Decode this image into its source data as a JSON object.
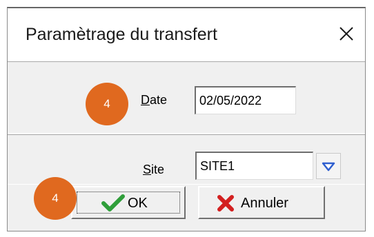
{
  "dialog": {
    "title": "Paramètrage du transfert",
    "close_icon": "close-icon"
  },
  "date": {
    "label_accel": "D",
    "label_rest": "ate",
    "value": "02/05/2022"
  },
  "site": {
    "label_accel": "S",
    "label_rest": "ite",
    "value": "SITE1",
    "dropdown_icon": "chevron-down-icon"
  },
  "buttons": {
    "ok_label": "OK",
    "ok_icon": "check-icon",
    "cancel_label": "Annuler",
    "cancel_icon": "cross-icon"
  },
  "annotations": {
    "step_date": "4",
    "step_ok": "4"
  },
  "colors": {
    "badge": "#e0691f",
    "check": "#2f9e3a",
    "cross": "#d32020",
    "dropdown_arrow": "#2f5fcf"
  }
}
